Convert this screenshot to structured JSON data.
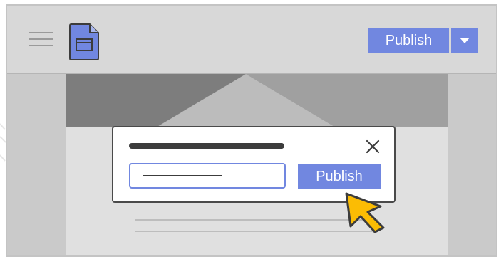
{
  "header": {
    "menu_icon": "hamburger-menu-icon",
    "site_icon": "google-sites-icon",
    "publish_label": "Publish",
    "publish_dropdown_icon": "triangle-down-icon"
  },
  "dialog": {
    "publish_label": "Publish",
    "close_icon": "close-icon"
  },
  "cursor": {
    "icon": "mouse-pointer-icon"
  },
  "colors": {
    "accent": "#7187e0",
    "cursor_fill": "#fbbc04",
    "dark": "#3c3c3c",
    "header_bg": "#d8d8d8",
    "page_bg": "#cacaca",
    "canvas_bg": "#e0e0e0"
  }
}
